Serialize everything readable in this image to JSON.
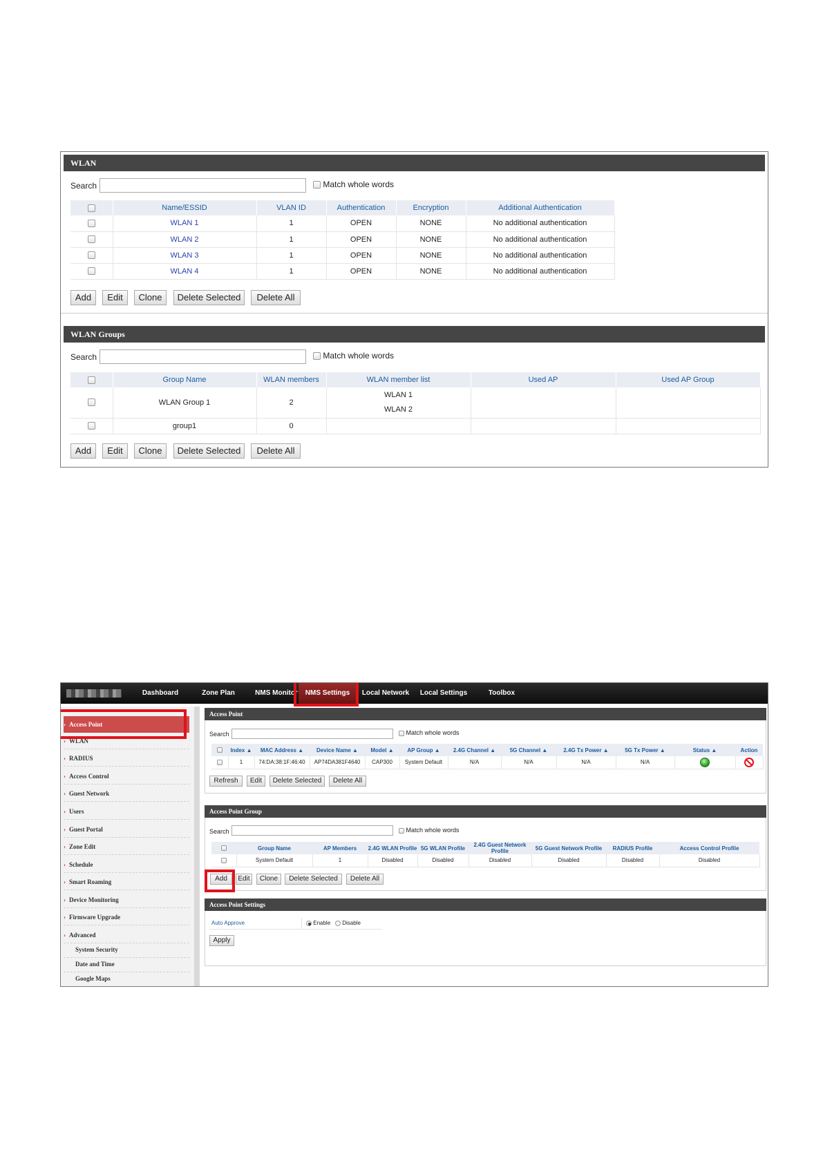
{
  "wlan_panel": {
    "title": "WLAN",
    "search_label": "Search",
    "match_label": "Match whole words",
    "columns": [
      "Name/ESSID",
      "VLAN ID",
      "Authentication",
      "Encryption",
      "Additional Authentication"
    ],
    "rows": [
      [
        "WLAN 1",
        "1",
        "OPEN",
        "NONE",
        "No additional authentication"
      ],
      [
        "WLAN 2",
        "1",
        "OPEN",
        "NONE",
        "No additional authentication"
      ],
      [
        "WLAN 3",
        "1",
        "OPEN",
        "NONE",
        "No additional authentication"
      ],
      [
        "WLAN 4",
        "1",
        "OPEN",
        "NONE",
        "No additional authentication"
      ]
    ],
    "buttons": {
      "add": "Add",
      "edit": "Edit",
      "clone": "Clone",
      "delete_selected": "Delete Selected",
      "delete_all": "Delete All"
    }
  },
  "wlan_groups_panel": {
    "title": "WLAN Groups",
    "search_label": "Search",
    "match_label": "Match whole words",
    "columns": [
      "Group Name",
      "WLAN members",
      "WLAN member list",
      "Used AP",
      "Used AP Group"
    ],
    "rows": [
      {
        "name": "WLAN Group 1",
        "members": "2",
        "list": [
          "WLAN 1",
          "WLAN 2"
        ],
        "used_ap": "",
        "used_ap_group": ""
      },
      {
        "name": "group1",
        "members": "0",
        "list": [],
        "used_ap": "",
        "used_ap_group": ""
      }
    ],
    "buttons": {
      "add": "Add",
      "edit": "Edit",
      "clone": "Clone",
      "delete_selected": "Delete Selected",
      "delete_all": "Delete All"
    }
  },
  "nms": {
    "nav": [
      "Dashboard",
      "Zone Plan",
      "NMS Monitor",
      "NMS Settings",
      "Local Network",
      "Local Settings",
      "Toolbox"
    ],
    "active_nav": "NMS Settings",
    "highlight_color": "#e0131b",
    "sidebar": [
      "Access Point",
      "WLAN",
      "RADIUS",
      "Access Control",
      "Guest Network",
      "Users",
      "Guest Portal",
      "Zone Edit",
      "Schedule",
      "Smart Roaming",
      "Device Monitoring",
      "Firmware Upgrade",
      "Advanced"
    ],
    "sidebar_sub": [
      "System Security",
      "Date and Time",
      "Google Maps"
    ],
    "access_point": {
      "title": "Access Point",
      "search_label": "Search",
      "match_label": "Match whole words",
      "columns": [
        "Index ▲",
        "MAC Address ▲",
        "Device Name ▲",
        "Model ▲",
        "AP Group ▲",
        "2.4G Channel ▲",
        "5G Channel ▲",
        "2.4G Tx Power ▲",
        "5G Tx Power ▲",
        "Status ▲",
        "Action"
      ],
      "row": [
        "1",
        "74:DA:38:1F:46:40",
        "AP74DA381F4640",
        "CAP300",
        "System Default",
        "N/A",
        "N/A",
        "N/A",
        "N/A"
      ],
      "status_icon": "status-online-icon",
      "action_icon": "block-icon",
      "buttons": {
        "refresh": "Refresh",
        "edit": "Edit",
        "delete_selected": "Delete Selected",
        "delete_all": "Delete All"
      }
    },
    "ap_group": {
      "title": "Access Point Group",
      "search_label": "Search",
      "match_label": "Match whole words",
      "columns": [
        "Group Name",
        "AP Members",
        "2.4G WLAN Profile",
        "5G WLAN Profile",
        "2.4G Guest Network Profile",
        "5G Guest Network Profile",
        "RADIUS Profile",
        "Access Control Profile"
      ],
      "row": [
        "System Default",
        "1",
        "Disabled",
        "Disabled",
        "Disabled",
        "Disabled",
        "Disabled",
        "Disabled"
      ],
      "buttons": {
        "add": "Add",
        "edit": "Edit",
        "clone": "Clone",
        "delete_selected": "Delete Selected",
        "delete_all": "Delete All"
      }
    },
    "ap_settings": {
      "title": "Access Point Settings",
      "auto_approve_label": "Auto Approve",
      "enable_label": "Enable",
      "disable_label": "Disable",
      "selected": "Enable",
      "apply": "Apply"
    }
  }
}
